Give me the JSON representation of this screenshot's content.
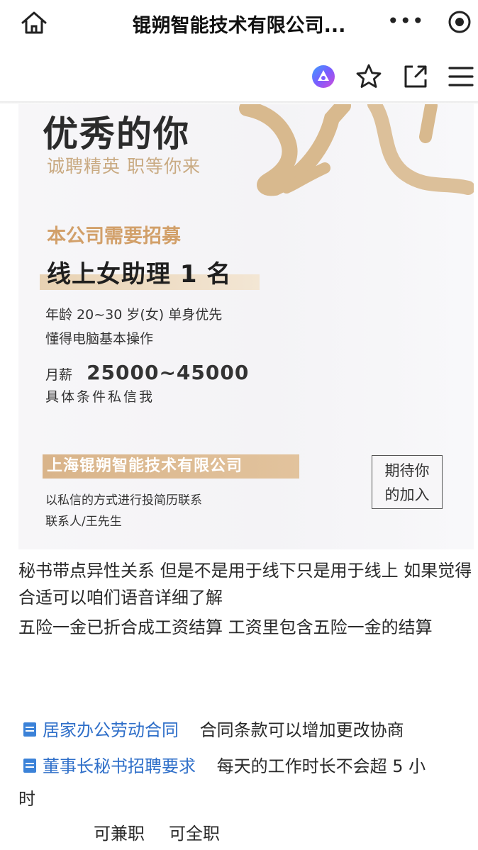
{
  "header": {
    "title": "锟朔智能技术有限公司...",
    "more_label": "•••"
  },
  "poster": {
    "heading": "优秀的你",
    "tagline": "诚聘精英  职等你来",
    "recruit_label": "本公司需要招募",
    "position": "线上女助理 1 名",
    "requirements": [
      "年龄 20~30 岁(女) 单身优先",
      "懂得电脑基本操作"
    ],
    "salary_label": "月薪",
    "salary_value": "25000~45000",
    "conditions": "具体条件私信我",
    "company": "上海锟朔智能技术有限公司",
    "contact_lines": [
      "以私信的方式进行投简历联系",
      "联系人/王先生"
    ],
    "await_lines": [
      "期待你",
      "的加入"
    ]
  },
  "post": {
    "paragraph1": "秘书带点异性关系  但是不是用于线下只是用于线上  如果觉得合适可以咱们语音详细了解",
    "paragraph2": "五险一金已折合成工资结算  工资里包含五险一金的结算",
    "documents": [
      {
        "label": "居家办公劳动合同",
        "note": "合同条款可以增加更改协商"
      },
      {
        "label": "董事长秘书招聘要求",
        "note": "每天的工作时长不会超 5 小"
      }
    ],
    "note_tail": "时",
    "job_types": [
      "可兼职",
      "可全职"
    ]
  },
  "icons": {
    "home": "home-icon",
    "mini_program": "target-icon",
    "app_logo": "app-logo-icon",
    "favorite": "star-icon",
    "share": "share-out-icon",
    "menu": "hamburger-menu-icon",
    "document": "document-icon"
  },
  "colors": {
    "link": "#2f6fc9",
    "poster_gold": "#d2a06a",
    "poster_background": "#f5f4f7"
  }
}
